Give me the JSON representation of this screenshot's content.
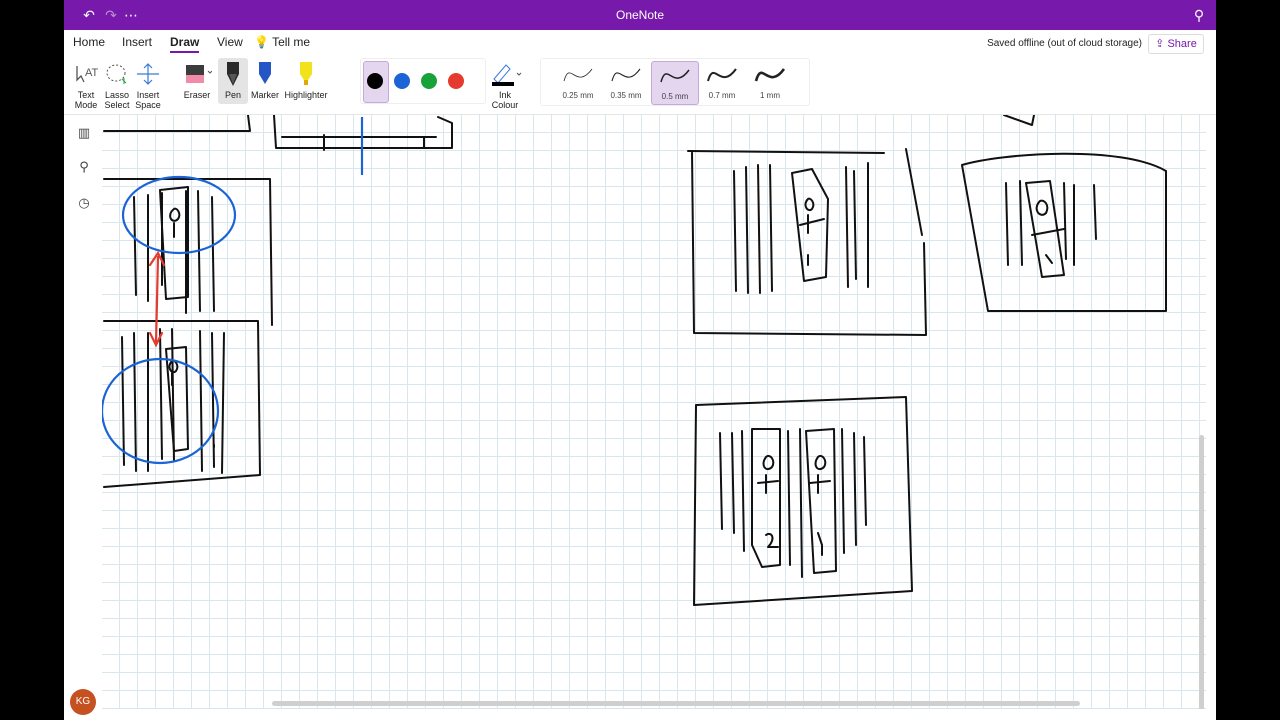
{
  "app": {
    "title": "OneNote"
  },
  "titlebar": {
    "undo_icon": "undo-icon",
    "redo_icon": "redo-icon",
    "more_icon": "ellipsis-icon",
    "feedback_icon": "feedback-icon"
  },
  "tabs": [
    {
      "label": "Home"
    },
    {
      "label": "Insert"
    },
    {
      "label": "Draw",
      "active": true
    },
    {
      "label": "View"
    },
    {
      "label": "Tell me"
    }
  ],
  "status": {
    "saved": "Saved offline (out of cloud storage)"
  },
  "share": {
    "label": "Share"
  },
  "tools": {
    "text_mode": "Text\nMode",
    "lasso": "Lasso\nSelect",
    "insert_space": "Insert\nSpace",
    "eraser": "Eraser",
    "pen": "Pen",
    "marker": "Marker",
    "highlighter": "Highlighter",
    "ink_colour": "Ink\nColour"
  },
  "colors": {
    "accent": "#7719aa",
    "black": "#000000",
    "blue": "#1a64d6",
    "green": "#18a33a",
    "red": "#e53b2f"
  },
  "widths": [
    {
      "label": "0.25 mm"
    },
    {
      "label": "0.35 mm"
    },
    {
      "label": "0.5 mm",
      "selected": true
    },
    {
      "label": "0.7 mm"
    },
    {
      "label": "1 mm"
    }
  ],
  "user": {
    "initials": "KG"
  }
}
